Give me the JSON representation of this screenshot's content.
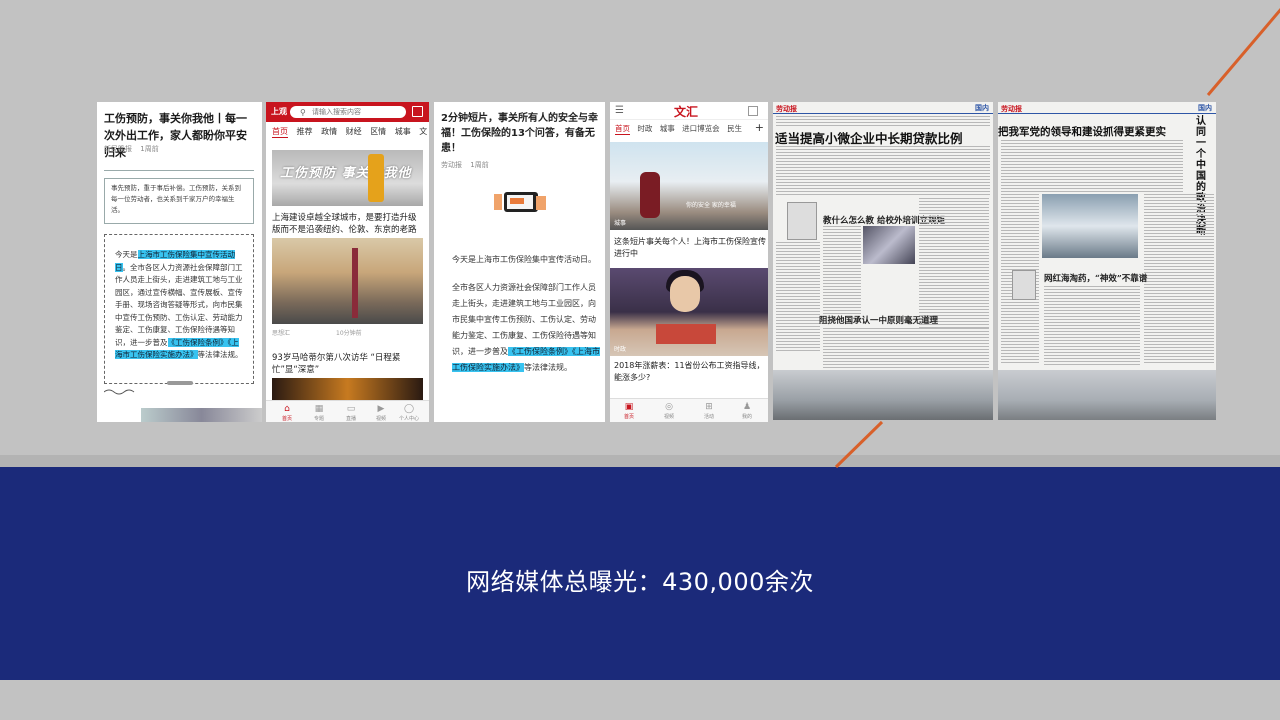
{
  "caption": "网络媒体总曝光：430,000余次",
  "colors": {
    "band": "#1b2a7a",
    "accent_line": "#d8602a",
    "highlight": "#38c3f0",
    "brand_red": "#c8141e"
  },
  "card1": {
    "title": "工伤预防，事关你我他丨每一次外出工作，家人都盼你平安归来",
    "source": "新民晚报",
    "time": "1周前",
    "quote": "事先预防，重于事后补偿。工伤预防，关系到每一位劳动者，也关系到千家万户的幸福生活。",
    "p_start": "今天是",
    "p_hl1": "上海市工伤保险集中宣传活动日",
    "p_mid": "。全市各区人力资源社会保障部门工作人员走上街头，走进建筑工地与工业园区，通过宣传横幅、宣传展板、宣传手册、现场咨询答疑等形式，向市民集中宣传工伤预防、工伤认定、劳动能力鉴定、工伤康复、工伤保险待遇等知识，进一步普及",
    "p_hl2": "《工伤保险条例》《上海市工伤保险实施办法》",
    "p_end": "等法律法规。"
  },
  "card2": {
    "logo": "上观",
    "search_placeholder": "请输入搜索内容",
    "tabs": [
      "首页",
      "推荐",
      "政情",
      "财经",
      "区情",
      "城事",
      "文"
    ],
    "hero_text": "工伤预防 事关你我他",
    "headline1": "上海建设卓越全球城市，是要打造升级版而不是沿袭纽约、伦敦、东京的老路",
    "meta_source": "思想汇",
    "meta_time": "10分钟前",
    "headline2": "93岁马哈蒂尔第八次访华 “日程紧忙”显“深意”",
    "nav": [
      "首页",
      "专题",
      "直播",
      "视频",
      "个人中心"
    ]
  },
  "card3": {
    "title": "2分钟短片，事关所有人的安全与幸福！工伤保险的13个问答，有备无患！",
    "source": "劳动报",
    "time": "1周前",
    "p1": "今天是上海市工伤保险集中宣传活动日。",
    "p2": "全市各区人力资源社会保障部门工作人员走上街头，走进建筑工地与工业园区，向市民集中宣传工伤预防、工伤认定、劳动能力鉴定、工伤康复、工伤保险待遇等知识，进一步普及",
    "p2_hl": "《工伤保险条例》《上海市工伤保险实施办法》",
    "p2_end": "等法律法规。"
  },
  "card4": {
    "logo": "文汇",
    "tabs": [
      "首页",
      "时政",
      "城事",
      "进口博览会",
      "民生"
    ],
    "img1_caption": "你的安全 家的幸福",
    "img1_tag": "城事",
    "headline1": "这条短片事关每个人！上海市工伤保险宣传进行中",
    "img2_tag": "时政",
    "headline2": "2018年涨薪表：11省份公布工资指导线，能涨多少?",
    "nav": [
      "首页",
      "视频",
      "活动",
      "我的"
    ]
  },
  "paper1": {
    "masthead": "劳动报",
    "section": "国内",
    "headline": "适当提高小微企业中长期贷款比例",
    "sub1": "教什么怎么教 给校外培训立规矩",
    "sub2": "阻挠他国承认一中原则毫无道理"
  },
  "paper2": {
    "masthead": "劳动报",
    "section": "国内",
    "headline": "把我军党的领导和建设抓得更紧更实",
    "side": "认同一个中国的政治决断",
    "sub1": "网红海淘药，“神效”不靠谱"
  }
}
